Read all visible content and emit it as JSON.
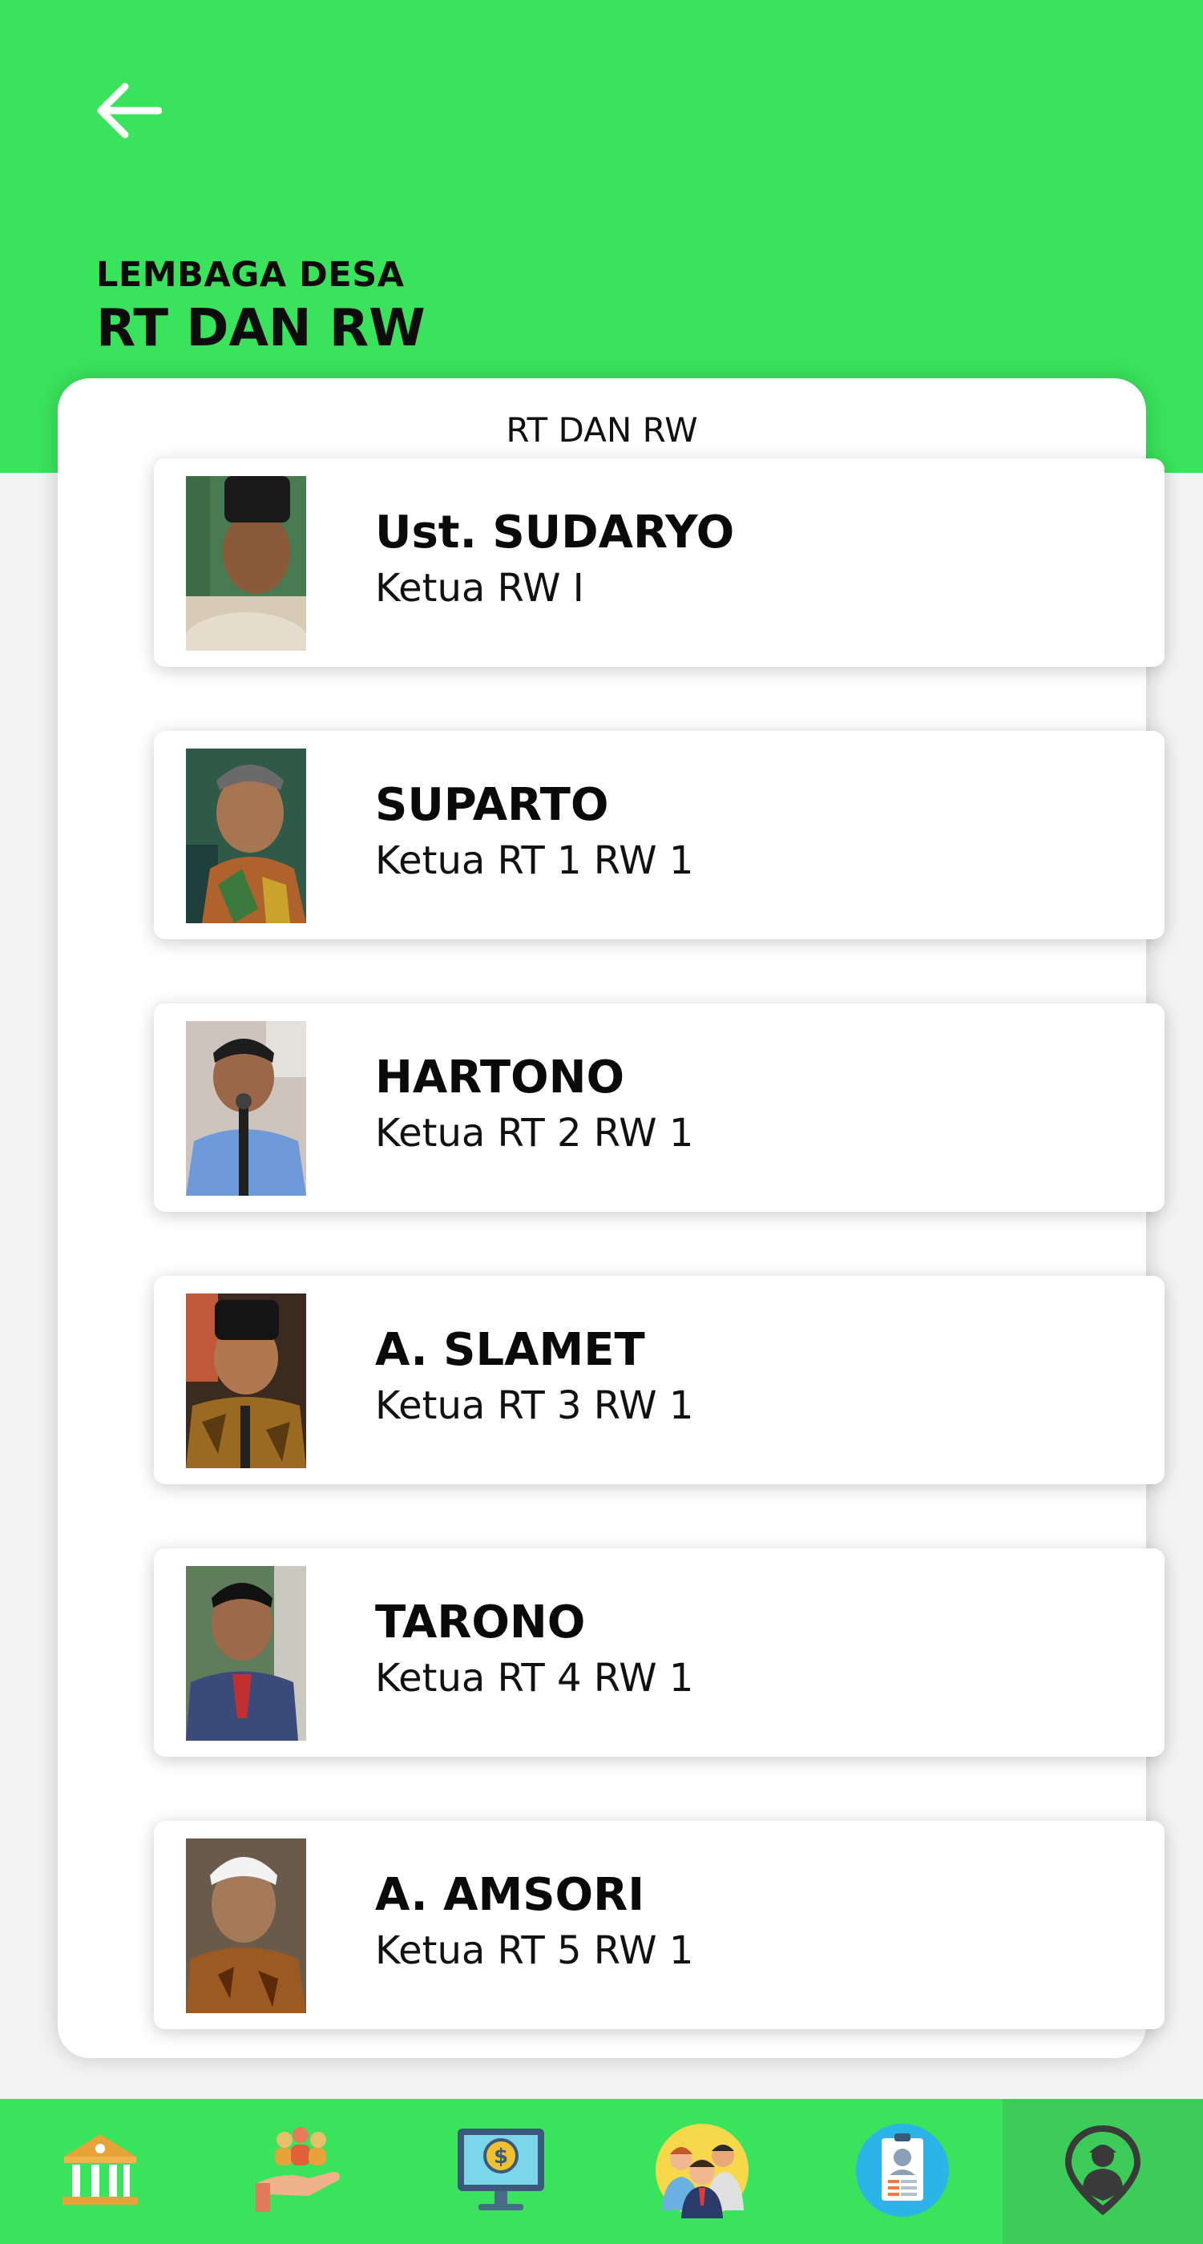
{
  "header": {
    "subtitle": "LEMBAGA DESA",
    "title": "RT DAN RW"
  },
  "panel": {
    "title": "RT DAN RW"
  },
  "officials": [
    {
      "name": "Ust. SUDARYO",
      "role": "Ketua RW I"
    },
    {
      "name": "SUPARTO",
      "role": "Ketua RT 1 RW 1"
    },
    {
      "name": "HARTONO",
      "role": "Ketua RT 2 RW 1"
    },
    {
      "name": "A. SLAMET",
      "role": "Ketua RT 3 RW 1"
    },
    {
      "name": "TARONO",
      "role": "Ketua RT 4 RW 1"
    },
    {
      "name": "A. AMSORI",
      "role": "Ketua RT 5 RW 1"
    }
  ],
  "nav": [
    {
      "icon": "institution-icon"
    },
    {
      "icon": "community-hand-icon"
    },
    {
      "icon": "finance-monitor-icon"
    },
    {
      "icon": "people-group-icon"
    },
    {
      "icon": "id-card-icon"
    },
    {
      "icon": "location-person-icon",
      "active": true
    }
  ],
  "colors": {
    "brand_green": "#3ae35c",
    "active_nav": "#3dcc58"
  }
}
